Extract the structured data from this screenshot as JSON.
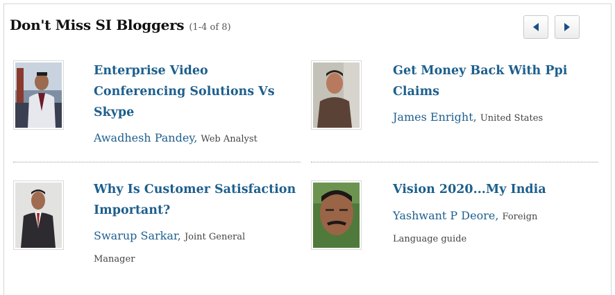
{
  "widget": {
    "title": "Don't Miss SI Bloggers",
    "count": "(1-4 of 8)",
    "prev_icon": "triangle-left",
    "next_icon": "triangle-right",
    "link_color": "#1d5f8d"
  },
  "items": [
    {
      "title": "Enterprise Video Conferencing Solutions Vs Skype",
      "author": "Awadhesh Pandey",
      "role": "Web Analyst"
    },
    {
      "title": "Get Money Back With Ppi Claims",
      "author": "James Enright",
      "role": "United States"
    },
    {
      "title": "Why Is Customer Satisfaction Important?",
      "author": "Swarup Sarkar",
      "role": "Joint General Manager"
    },
    {
      "title": "Vision 2020...My India",
      "author": "Yashwant P Deore",
      "role": "Foreign Language guide"
    }
  ]
}
